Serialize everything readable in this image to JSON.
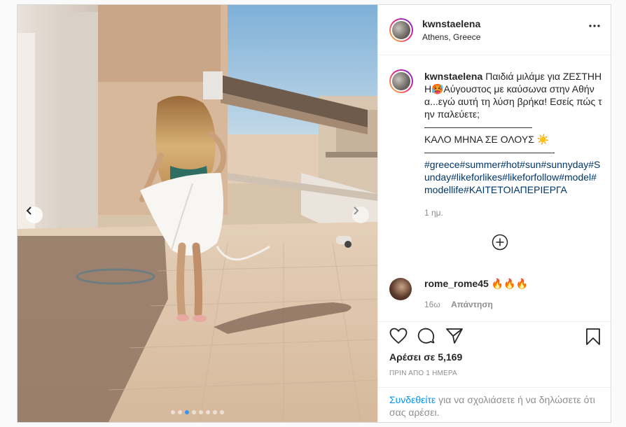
{
  "post": {
    "username": "kwnstaelena",
    "location": "Athens, Greece",
    "caption": {
      "username": "kwnstaelena",
      "line1": "Παιδιά μιλάμε για ΖΕΣΤΗΗΗ🥵Αύγουστος με καύσωνα στην Αθήνα...εγώ αυτή τη λύση βρήκα! Εσείς πώς την παλεύετε;",
      "divider1": "———————————",
      "line2": "ΚΑΛΟ ΜΗΝΑ ΣΕ ΟΛΟΥΣ ☀️",
      "divider2": "—————————————-",
      "hashtags": "#greece#summer#hot#sun#sunnyday#Sunday#likeforlikes#likeforfollow#model#modellife#ΚΑΙΤΕΤΟΙΑΠΕΡΙΕΡΓΑ"
    },
    "time_ago": "1 ημ.",
    "comment": {
      "username": "rome_rome45",
      "text": "🔥🔥🔥",
      "time": "16ω",
      "reply_label": "Απάντηση"
    },
    "likes_label": "Αρέσει σε 5,169",
    "date_label": "ΠΡΙΝ ΑΠΟ 1 ΗΜΕΡΑ",
    "login_link": "Συνδεθείτε",
    "login_rest": " για να σχολιάσετε ή να δηλώσετε ότι σας αρέσει."
  },
  "carousel": {
    "total": 8,
    "active_index": 2
  },
  "icons": {
    "more": "more-options-icon",
    "prev": "chevron-left-icon",
    "next": "chevron-right-icon",
    "load_more": "plus-circle-icon",
    "like": "heart-icon",
    "comment": "comment-icon",
    "share": "share-icon",
    "save": "bookmark-icon"
  },
  "colors": {
    "hashtag": "#00376b",
    "link": "#0095f6",
    "muted": "#8e8e8e",
    "active_dot": "#3797f0"
  }
}
